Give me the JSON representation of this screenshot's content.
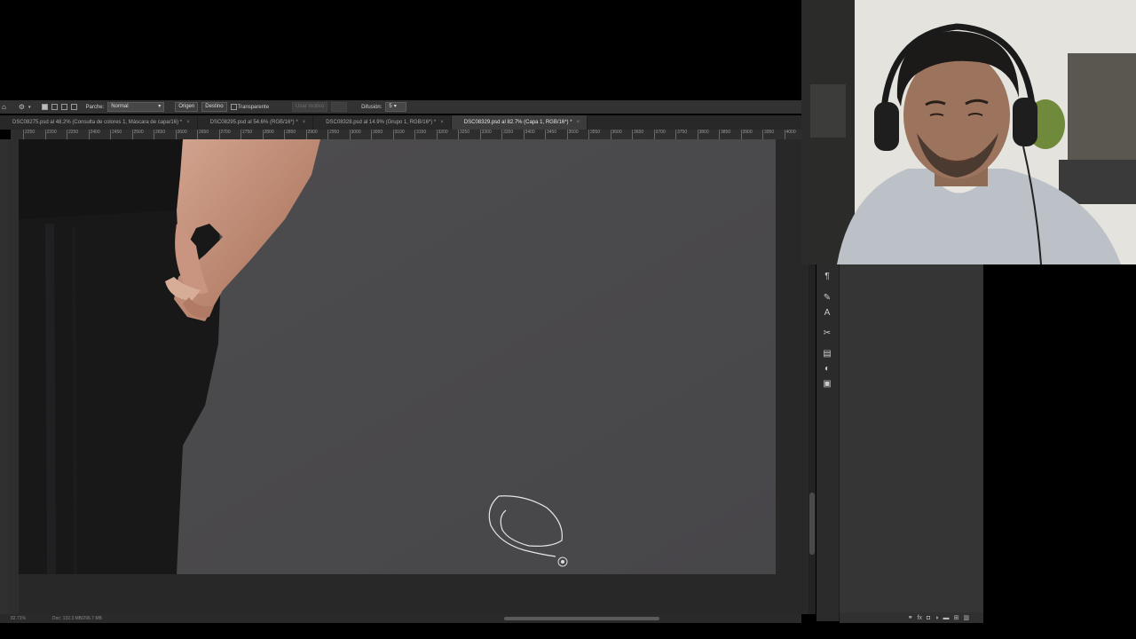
{
  "options_bar": {
    "patch_label": "Parche:",
    "patch_mode": "Normal",
    "source_button": "Origen",
    "destination_button": "Destino",
    "transparent_label": "Transparente",
    "use_pattern_button": "Usar motivo",
    "diffusion_label": "Difusión:",
    "diffusion_value": "5"
  },
  "tabs": [
    {
      "label": "DSC08275.psd al 48.2% (Consulta de colores 1, Máscara de capa/16) *",
      "active": false
    },
    {
      "label": "DSC08295.psd al 54.6% (RGB/16*) *",
      "active": false
    },
    {
      "label": "DSC08328.psd al 14.9% (Grupo 1, RGB/16*) *",
      "active": false
    },
    {
      "label": "DSC08329.psd al 82.7% (Capa 1, RGB/16*) *",
      "active": true
    }
  ],
  "ruler": {
    "ticks": [
      "2250",
      "2200",
      "2250",
      "2400",
      "2450",
      "2500",
      "2650",
      "2600",
      "2650",
      "2700",
      "2750",
      "2800",
      "2850",
      "2900",
      "2950",
      "3000",
      "3050",
      "3100",
      "3150",
      "3200",
      "3250",
      "3300",
      "3350",
      "3400",
      "3450",
      "3500",
      "3550",
      "3600",
      "3650",
      "3700",
      "3750",
      "3800",
      "3850",
      "3900",
      "3950",
      "4000"
    ]
  },
  "status": {
    "zoom": "82.71%",
    "doc": "Doc: 132.3 MB/296.7 MB"
  },
  "colors": {
    "ui_dark": "#282828",
    "panel": "#353535",
    "backdrop": "#4b4a4c",
    "subject": "#171718"
  }
}
